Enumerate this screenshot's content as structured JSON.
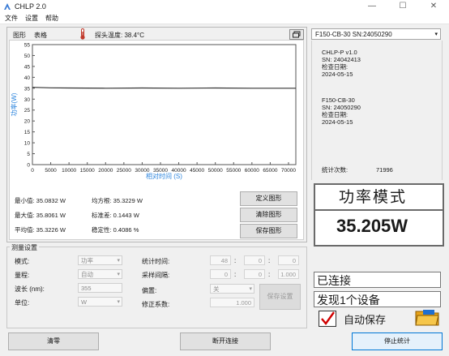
{
  "window": {
    "title": "CHLP 2.0",
    "minimize": "—",
    "maximize": "☐",
    "close": "✕"
  },
  "menu": [
    "文件",
    "设置",
    "帮助"
  ],
  "tabs": [
    "图形",
    "表格"
  ],
  "probe": {
    "label": "探头温度: 38.4°C"
  },
  "chart_data": {
    "type": "line",
    "xlabel": "相对时间 (S)",
    "ylabel": "功率(W)",
    "x_ticks": [
      "0",
      "5000",
      "10000",
      "15000",
      "20000",
      "25000",
      "30000",
      "35000",
      "40000",
      "45000",
      "50000",
      "55000",
      "60000",
      "65000",
      "70000"
    ],
    "y_ticks": [
      "0",
      "5",
      "10",
      "15",
      "20",
      "25",
      "30",
      "35",
      "40",
      "45",
      "50",
      "55"
    ],
    "xlim": [
      0,
      72000
    ],
    "ylim": [
      0,
      55
    ],
    "grid": false,
    "series": [
      {
        "x": [
          0,
          5000,
          10000,
          20000,
          30000,
          40000,
          50000,
          60000,
          70000,
          72000
        ],
        "y": [
          35.4,
          35.2,
          35.1,
          35.0,
          35.1,
          35.0,
          35.1,
          35.0,
          35.0,
          35.0
        ]
      }
    ],
    "line_color": "#333333"
  },
  "stats": {
    "min": "最小值: 35.0832 W",
    "rms": "均方根: 35.3229 W",
    "max": "最大值: 35.8061 W",
    "std": "标准差: 0.1443 W",
    "avg": "平均值: 35.3226 W",
    "stability": "稳定性: 0.4086 %"
  },
  "chart_buttons": {
    "define": "定义图形",
    "clear": "清除图形",
    "save": "保存图形"
  },
  "measurement": {
    "title": "测量设置",
    "mode_label": "模式:",
    "mode_value": "功率",
    "range_label": "量程:",
    "range_value": "自动",
    "wavelength_label": "波长 (nm):",
    "wavelength_value": "355",
    "unit_label": "单位:",
    "unit_value": "W",
    "stat_time_label": "统计时间:",
    "stat_time": [
      "48",
      "0",
      "0"
    ],
    "sample_label": "采样间隔:",
    "sample": [
      "0",
      "0",
      "1.000"
    ],
    "offset_label": "偏置:",
    "offset_value": "关",
    "correction_label": "修正系数:",
    "correction_value": "1.000",
    "save_settings": "保存设置"
  },
  "device": {
    "selector": "F150-CB-30    SN:24050290",
    "probe_lines": [
      "CHLP-P v1.0",
      "SN: 24042413",
      "检查日期:",
      "2024-05-15"
    ],
    "sensor_lines": [
      "F150-CB-30",
      "SN: 24050290",
      "检查日期:",
      "2024-05-15"
    ],
    "stat_count_label": "统计次数:",
    "stat_count": "71996"
  },
  "display": {
    "mode": "功率模式",
    "value": "35.205W"
  },
  "status": {
    "connection": "已连接",
    "found": "发现1个设备",
    "autosave": "自动保存"
  },
  "bottom": {
    "zero": "清零",
    "disconnect": "断开连接",
    "stop": "停止统计"
  }
}
